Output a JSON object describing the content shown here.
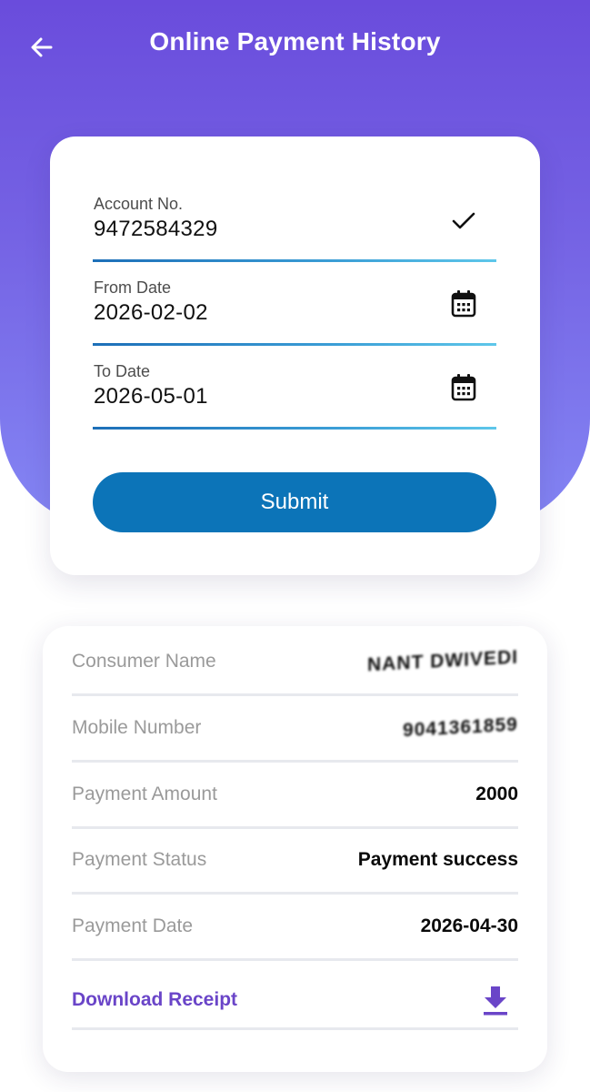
{
  "header": {
    "title": "Online Payment History",
    "back_icon": "arrow-left-icon"
  },
  "form": {
    "account": {
      "label": "Account No.",
      "value": "9472584329",
      "icon": "checkmark-icon"
    },
    "from_date": {
      "label": "From Date",
      "value": "2026-02-02",
      "icon": "calendar-icon"
    },
    "to_date": {
      "label": "To Date",
      "value": "2026-05-01",
      "icon": "calendar-icon"
    },
    "submit_label": "Submit"
  },
  "result": {
    "rows": [
      {
        "label": "Consumer Name",
        "value": "NANT DWIVEDI"
      },
      {
        "label": "Mobile Number",
        "value": "9041361859"
      },
      {
        "label": "Payment Amount",
        "value": "2000"
      },
      {
        "label": "Payment Status",
        "value": "Payment success"
      },
      {
        "label": "Payment Date",
        "value": "2026-04-30"
      }
    ],
    "download_label": "Download Receipt",
    "download_icon": "download-icon"
  },
  "colors": {
    "header_gradient_top": "#6a4cdc",
    "header_gradient_bottom": "#8486f4",
    "submit_button": "#0c74b8",
    "download_accent": "#6a45c8",
    "field_underline": "#3b9ed6"
  }
}
